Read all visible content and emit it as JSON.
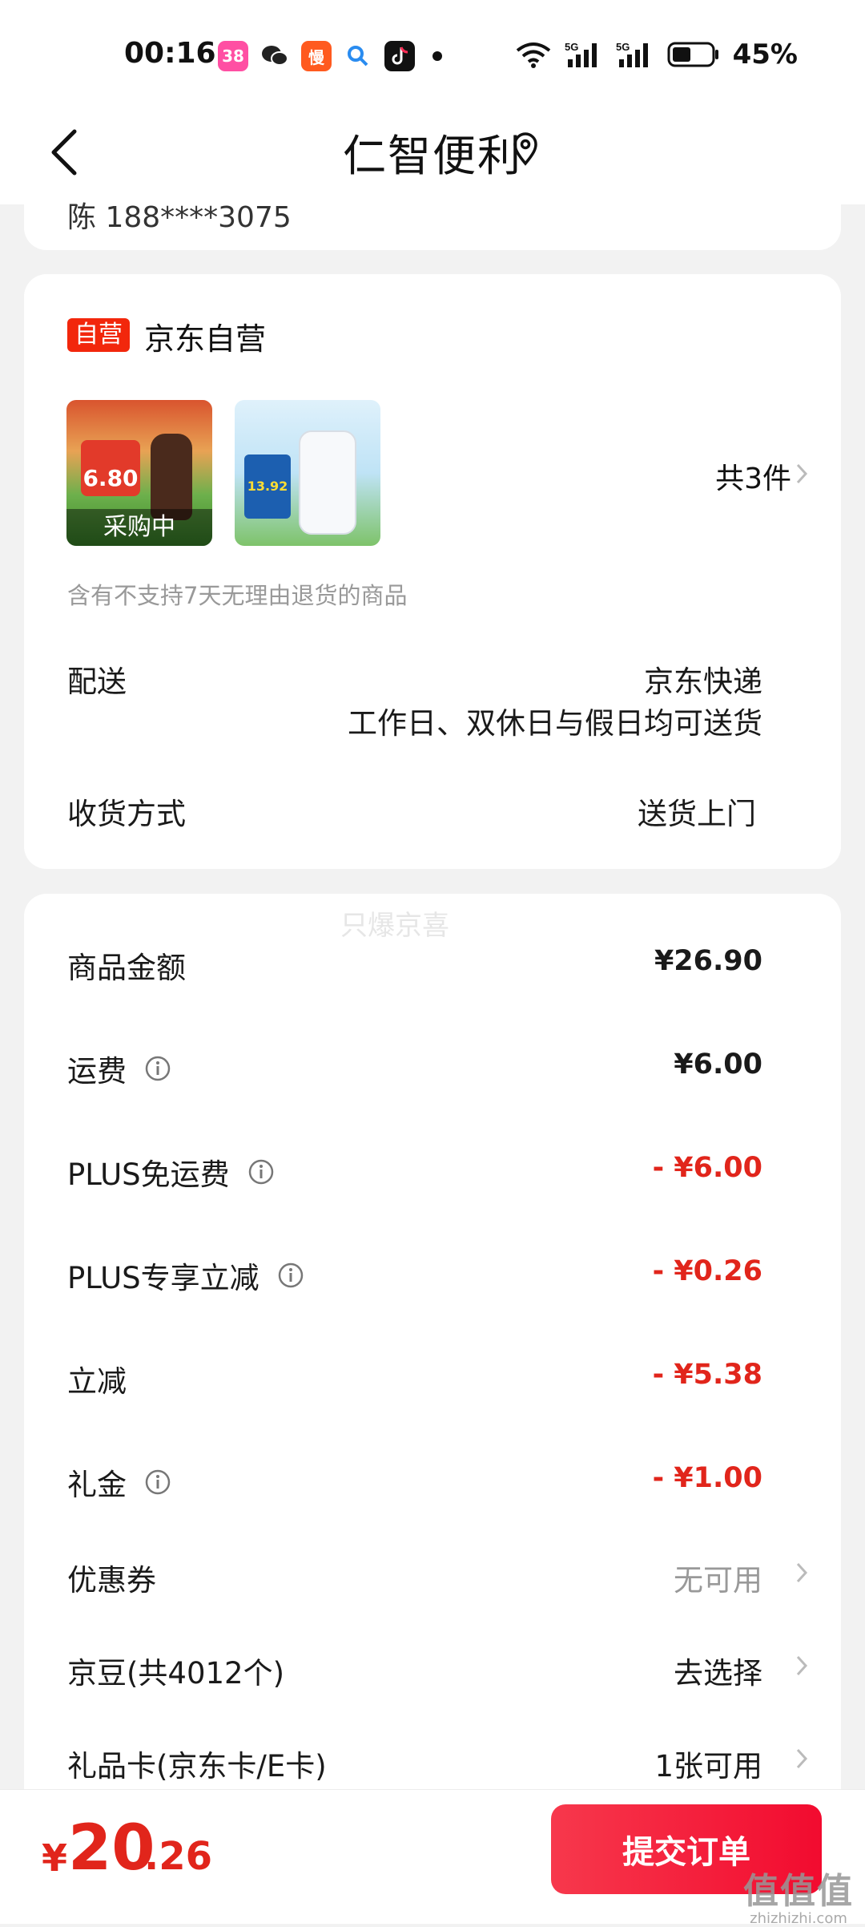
{
  "status_bar": {
    "time": "00:16",
    "battery": "45%",
    "app_icons": [
      {
        "name": "shopping-app-icon",
        "color": "#ff4fa3",
        "glyph": "38"
      },
      {
        "name": "wechat-icon",
        "color": "#1aad19",
        "glyph": "✉"
      },
      {
        "name": "lazy-app-icon",
        "color": "#ff5a1f",
        "glyph": "慢"
      },
      {
        "name": "search-app-icon",
        "color": "#2a8cf0",
        "glyph": "🔍"
      },
      {
        "name": "tiktok-icon",
        "color": "#111111",
        "glyph": "♪"
      }
    ]
  },
  "header": {
    "title": "仁智便利"
  },
  "address": {
    "masked": "陈 188****3075"
  },
  "store": {
    "badge": "自营",
    "name": "京东自营",
    "product1_tag": "6.80",
    "product1_overlay": "采购中",
    "product2_tag": "13.92",
    "count": "共3件",
    "return_note": "含有不支持7天无理由退货的商品",
    "delivery_label": "配送",
    "delivery_value": "京东快递",
    "delivery_note": "工作日、双休日与假日均可送货",
    "receive_label": "收货方式",
    "receive_value": "送货上门"
  },
  "fees": {
    "watermark": "只爆京喜",
    "rows": [
      {
        "label": "商品金额",
        "value": "¥26.90",
        "info": false
      },
      {
        "label": "运费",
        "value": "¥6.00",
        "info": true
      },
      {
        "label": "PLUS免运费",
        "value": "- ¥6.00",
        "info": true
      },
      {
        "label": "PLUS专享立减",
        "value": "- ¥0.26",
        "info": true
      },
      {
        "label": "立减",
        "value": "- ¥5.38",
        "info": false
      },
      {
        "label": "礼金",
        "value": "- ¥1.00",
        "info": true
      }
    ],
    "coupon_label": "优惠券",
    "coupon_value": "无可用",
    "beans_label": "京豆(共4012个)",
    "beans_value": "去选择",
    "giftcard_label": "礼品卡(京东卡/E卡)",
    "giftcard_value": "1张可用"
  },
  "bottom": {
    "currency": "¥",
    "total_int": "20",
    "total_dec": ".26",
    "submit": "提交订单",
    "site_big": "值值值",
    "site_small": "zhizhizhi.com"
  },
  "colors": {
    "accent_red": "#e1251b",
    "badge_red": "#f2270c"
  }
}
